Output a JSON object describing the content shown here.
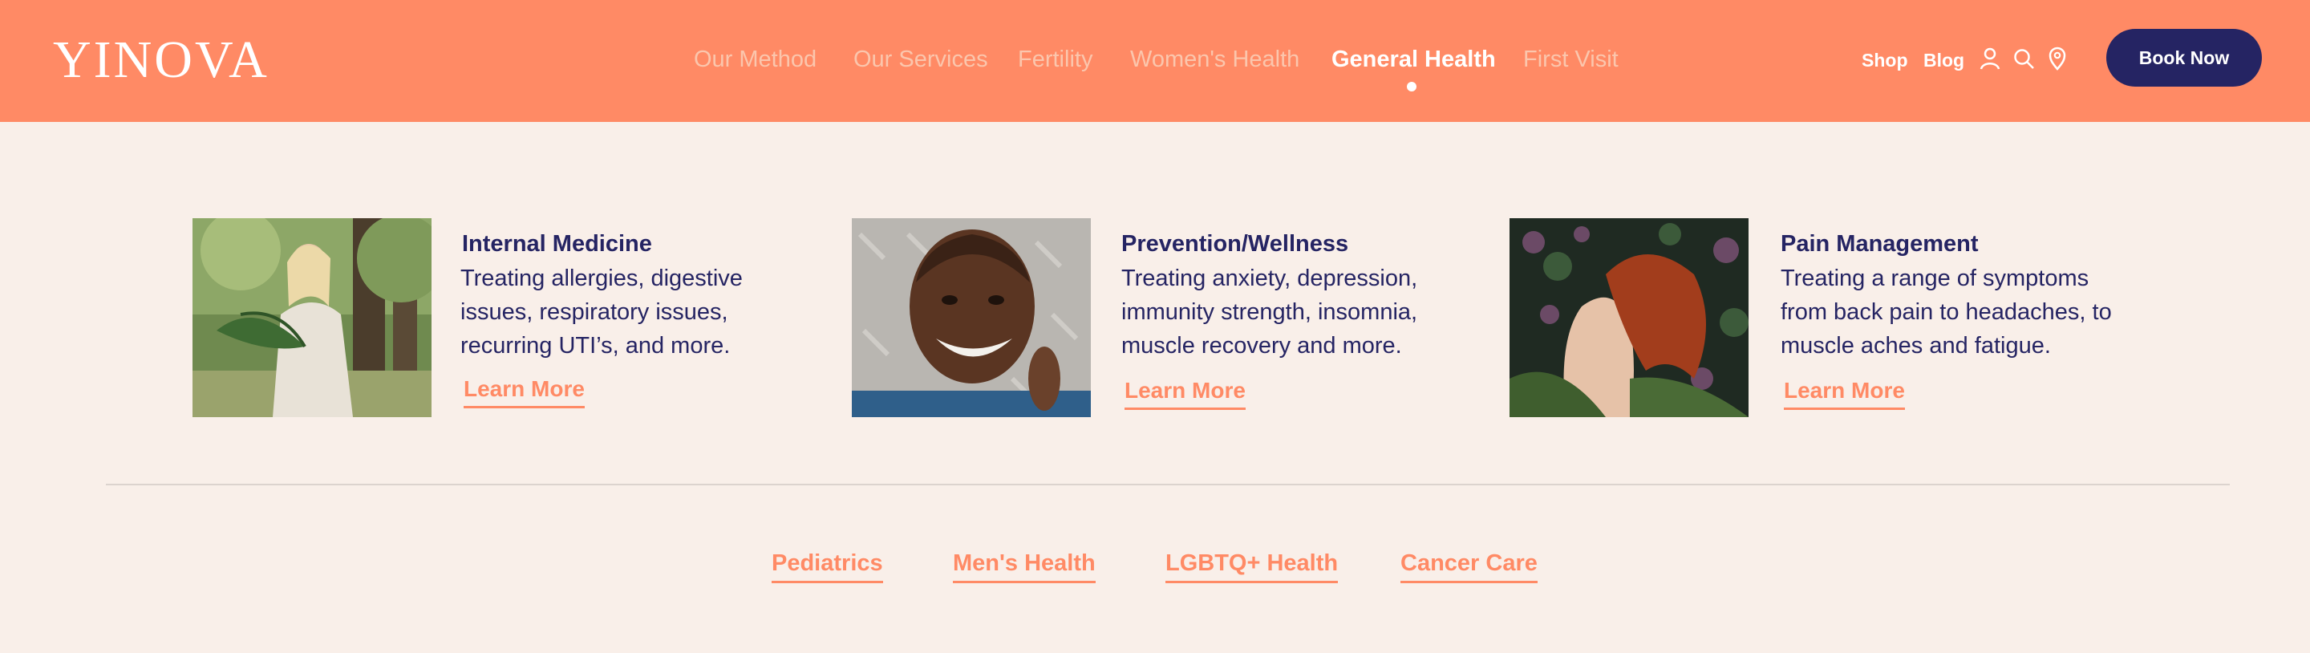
{
  "header": {
    "logo": "YINOVA",
    "nav": [
      {
        "label": "Our Method",
        "active": false
      },
      {
        "label": "Our Services",
        "active": false
      },
      {
        "label": "Fertility",
        "active": false
      },
      {
        "label": "Women's Health",
        "active": false
      },
      {
        "label": "General Health",
        "active": true
      },
      {
        "label": "First Visit",
        "active": false
      }
    ],
    "utility": {
      "shop": "Shop",
      "blog": "Blog",
      "icons": [
        "user-icon",
        "search-icon",
        "location-pin-icon"
      ]
    },
    "book_button": "Book Now"
  },
  "cards": [
    {
      "title": "Internal Medicine",
      "description": "Treating allergies, digestive issues, respiratory issues, recurring UTI’s, and more.",
      "link": "Learn More"
    },
    {
      "title": "Prevention/Wellness",
      "description": "Treating anxiety, depression, immunity strength, insomnia, muscle recovery and more.",
      "link": "Learn More"
    },
    {
      "title": "Pain Management",
      "description": "Treating a range of symptoms from back pain to headaches, to muscle aches and fatigue.",
      "link": "Learn More"
    }
  ],
  "more_links": [
    "Pediatrics",
    "Men's Health",
    "LGBTQ+ Health",
    "Cancer Care"
  ],
  "colors": {
    "header_bg": "#ff8a65",
    "page_bg": "#f9efe9",
    "navy": "#252463",
    "accent": "#ff8a65",
    "nav_inactive": "#fbc6ad"
  }
}
